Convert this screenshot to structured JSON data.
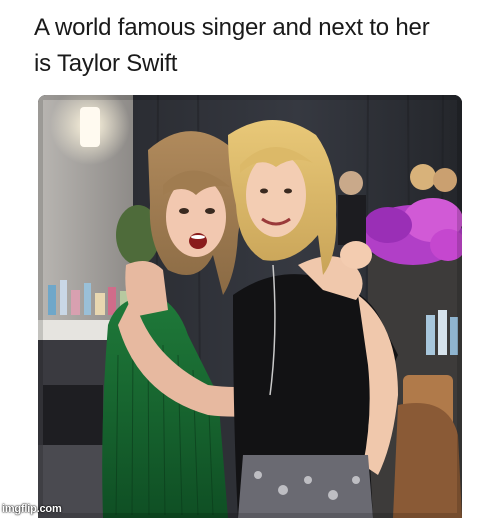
{
  "caption": {
    "line1": "A world famous singer and next to her",
    "line2": "is Taylor Swift"
  },
  "photo": {
    "subject": "photo-of-two-women-hugging"
  },
  "watermark": {
    "text": "imgflip.com"
  }
}
